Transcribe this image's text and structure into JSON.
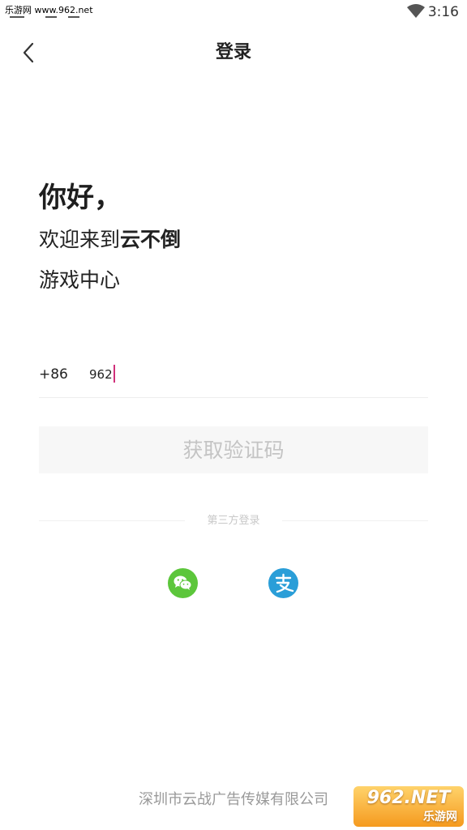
{
  "status_bar": {
    "watermark_text": "乐游网 www.962.net",
    "time": "3:16"
  },
  "header": {
    "title": "登录"
  },
  "greeting": {
    "hello": "你好，",
    "welcome_prefix": "欢迎来到",
    "brand": "云不倒",
    "subtitle": "游戏中心"
  },
  "login_form": {
    "country_code": "+86",
    "phone_value": "962",
    "get_code_label": "获取验证码"
  },
  "third_party": {
    "label": "第三方登录",
    "providers": [
      "wechat",
      "alipay"
    ]
  },
  "footer": {
    "company": "深圳市云战广告传媒有限公司"
  },
  "watermark_logo": {
    "top_text": "962.NET",
    "bottom_text": "乐游网"
  },
  "colors": {
    "caret": "#d0307a",
    "wechat": "#5cc63b",
    "alipay": "#2a9ed8",
    "disabled_button_bg": "#f7f7f7",
    "disabled_button_text": "#c4c4c4"
  },
  "icons": [
    "wifi-icon",
    "back-arrow-icon",
    "wechat-icon",
    "alipay-icon"
  ]
}
